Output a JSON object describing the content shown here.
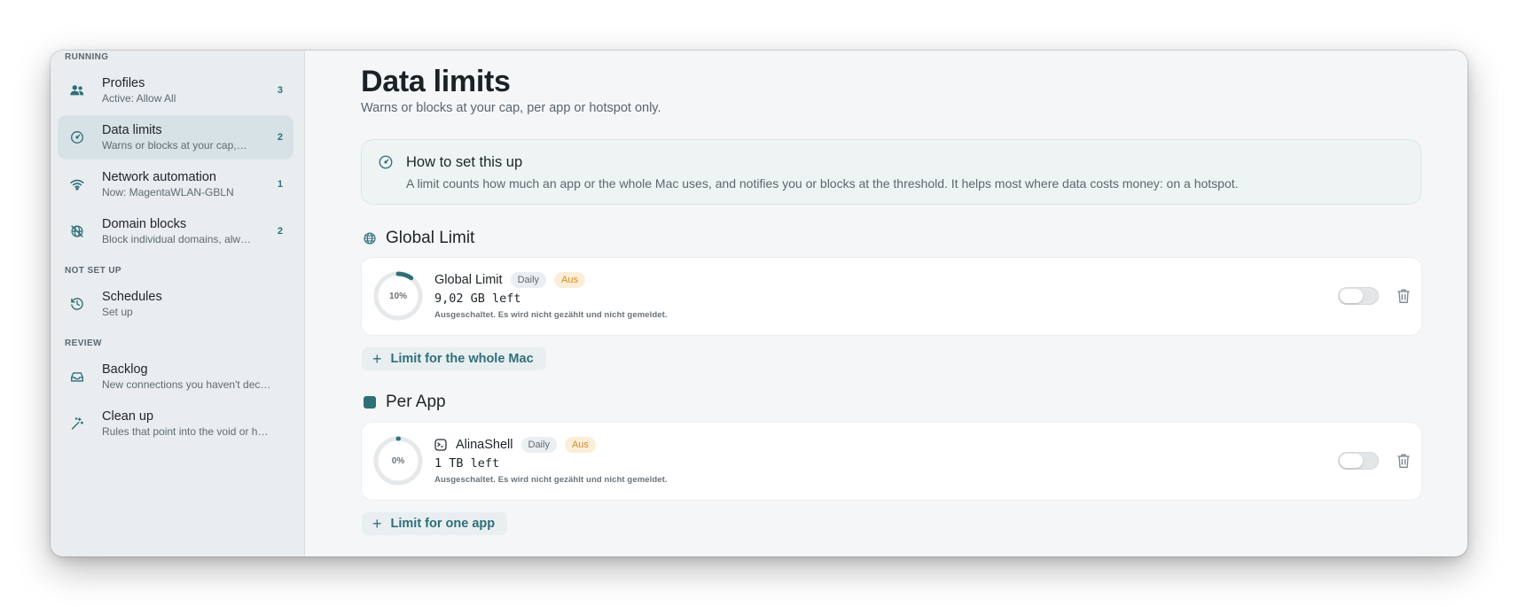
{
  "sidebar": {
    "sections": [
      {
        "label": "RUNNING",
        "items": [
          {
            "title": "Profiles",
            "subtitle": "Active: Allow All",
            "count": "3",
            "icon": "people-icon"
          },
          {
            "title": "Data limits",
            "subtitle": "Warns or blocks at your cap,…",
            "count": "2",
            "icon": "gauge-icon"
          },
          {
            "title": "Network automation",
            "subtitle": "Now: MagentaWLAN-GBLN",
            "count": "1",
            "icon": "wifi-icon"
          },
          {
            "title": "Domain blocks",
            "subtitle": "Block individual domains, alw…",
            "count": "2",
            "icon": "globe-blocked-icon"
          }
        ]
      },
      {
        "label": "NOT SET UP",
        "items": [
          {
            "title": "Schedules",
            "subtitle": "Set up",
            "icon": "clock-icon"
          }
        ]
      },
      {
        "label": "REVIEW",
        "items": [
          {
            "title": "Backlog",
            "subtitle": "New connections you haven't dec…",
            "icon": "tray-icon"
          },
          {
            "title": "Clean up",
            "subtitle": "Rules that point into the void or h…",
            "icon": "wand-icon"
          }
        ]
      }
    ]
  },
  "main": {
    "title": "Data limits",
    "subtitle": "Warns or blocks at your cap, per app or hotspot only.",
    "howto": {
      "title": "How to set this up",
      "text": "A limit counts how much an app or the whole Mac uses, and notifies you or blocks at the threshold. It helps most where data costs money: on a hotspot."
    },
    "global": {
      "heading": "Global Limit",
      "card": {
        "name": "Global Limit",
        "period": "Daily",
        "status": "Aus",
        "progress_label": "10%",
        "progress": 0.1,
        "remaining": "9,02 GB left",
        "note": "Ausgeschaltet. Es wird nicht gezählt und nicht gemeldet.",
        "enabled": false
      },
      "add_label": "Limit for the whole Mac"
    },
    "per_app": {
      "heading": "Per App",
      "card": {
        "name": "AlinaShell",
        "period": "Daily",
        "status": "Aus",
        "progress_label": "0%",
        "progress": 0.0,
        "remaining": "1 TB left",
        "note": "Ausgeschaltet. Es wird nicht gezählt und nicht gemeldet.",
        "enabled": false
      },
      "add_label": "Limit for one app"
    }
  },
  "colors": {
    "accent": "#2f6f78",
    "orange": "#d98a1e",
    "sidebar_active": "#d7e2e6"
  }
}
